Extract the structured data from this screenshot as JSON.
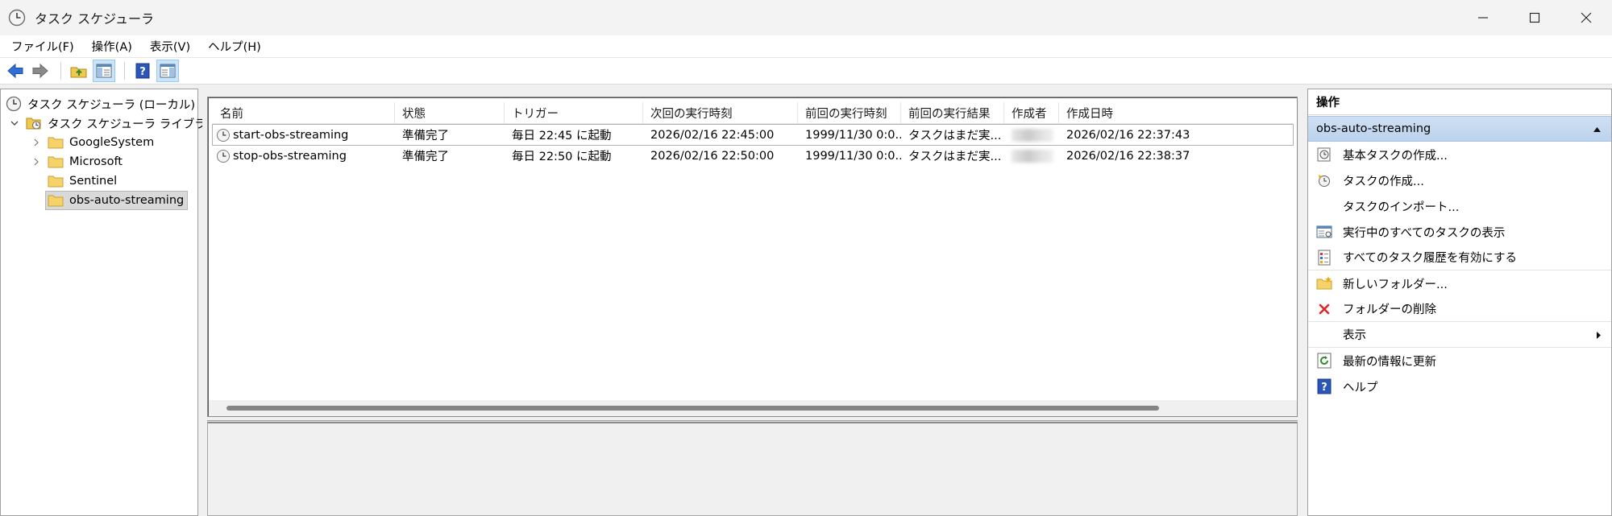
{
  "window": {
    "title": "タスク スケジューラ",
    "controls": [
      "minimize",
      "maximize",
      "close"
    ]
  },
  "menu": [
    "ファイル(F)",
    "操作(A)",
    "表示(V)",
    "ヘルプ(H)"
  ],
  "toolbar": [
    "back-arrow-icon",
    "forward-arrow-icon",
    "up-folder-icon",
    "show-hide-tree-icon",
    "help-icon",
    "show-hide-action-pane-icon"
  ],
  "tree": {
    "root": "タスク スケジューラ (ローカル)",
    "library": "タスク スケジューラ ライブラリ",
    "folders": [
      "GoogleSystem",
      "Microsoft",
      "Sentinel",
      "obs-auto-streaming"
    ],
    "selected": "obs-auto-streaming"
  },
  "task_list": {
    "columns": [
      "名前",
      "状態",
      "トリガー",
      "次回の実行時刻",
      "前回の実行時刻",
      "前回の実行結果",
      "作成者",
      "作成日時"
    ],
    "rows": [
      {
        "name": "start-obs-streaming",
        "status": "準備完了",
        "trigger": "毎日 22:45 に起動",
        "next_run": "2026/02/16 22:45:00",
        "last_run": "1999/11/30 0:0...",
        "last_result": "タスクはまだ実...",
        "author": "",
        "created": "2026/02/16 22:37:43"
      },
      {
        "name": "stop-obs-streaming",
        "status": "準備完了",
        "trigger": "毎日 22:50 に起動",
        "next_run": "2026/02/16 22:50:00",
        "last_run": "1999/11/30 0:0...",
        "last_result": "タスクはまだ実...",
        "author": "",
        "created": "2026/02/16 22:38:37"
      }
    ]
  },
  "actions": {
    "header": "操作",
    "section": "obs-auto-streaming",
    "items": [
      "基本タスクの作成...",
      "タスクの作成...",
      "タスクのインポート...",
      "実行中のすべてのタスクの表示",
      "すべてのタスク履歴を有効にする",
      "新しいフォルダー...",
      "フォルダーの削除",
      "表示",
      "最新の情報に更新",
      "ヘルプ"
    ]
  },
  "colors": {
    "accent_blue": "#2e6fd8",
    "selection_gray": "#d9d9d9",
    "section_header": "#c6d9ef",
    "delete_red": "#d92b2b",
    "folder_yellow": "#f2c94c"
  }
}
